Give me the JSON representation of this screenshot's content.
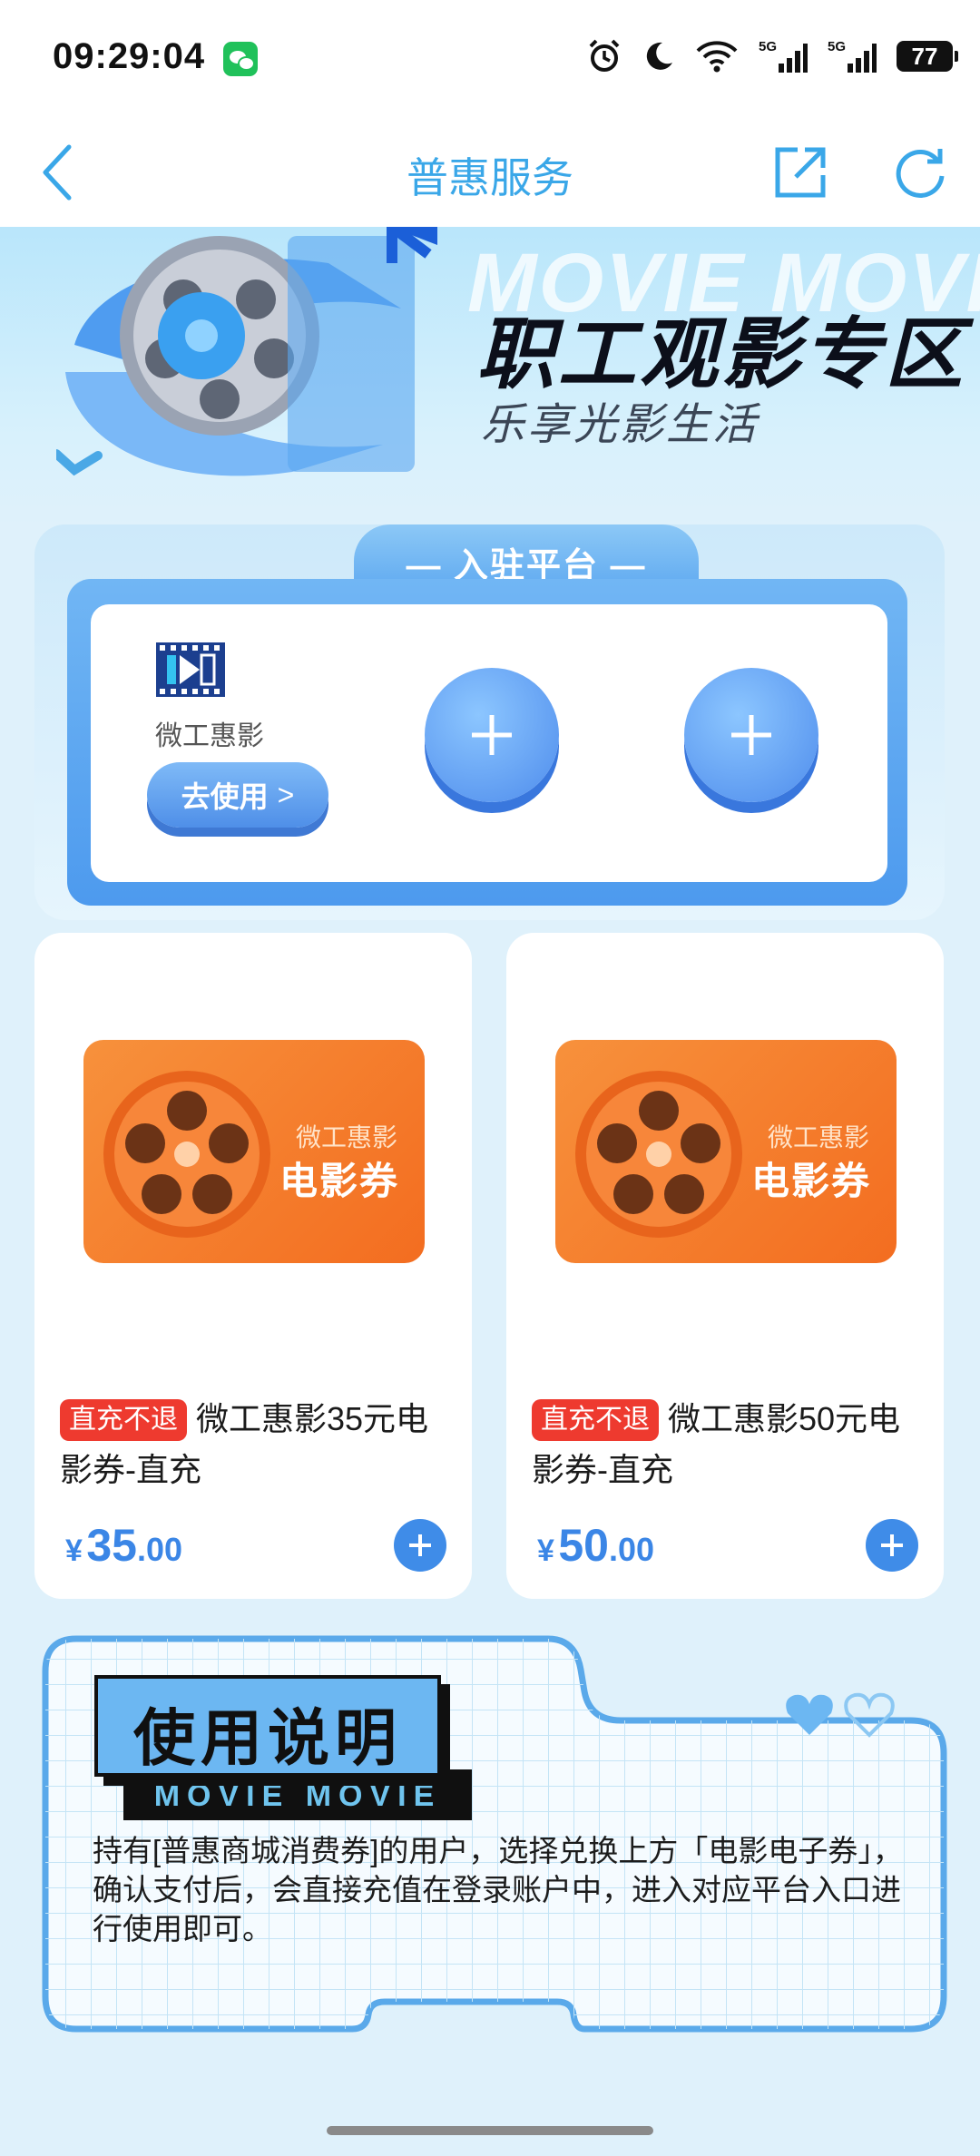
{
  "status_bar": {
    "time": "09:29:04",
    "icons": [
      "wechat-icon",
      "alarm-icon",
      "do-not-disturb-icon",
      "wifi-icon",
      "5g-signal-icon",
      "5g-signal-icon"
    ],
    "signal_labels": [
      "5G",
      "5G"
    ],
    "battery": "77"
  },
  "nav": {
    "title": "普惠服务",
    "back_icon": "chevron-left-icon",
    "share_icon": "share-external-icon",
    "refresh_icon": "refresh-icon"
  },
  "banner": {
    "watermark": "MOVIE MOVIE",
    "title": "职工观影专区",
    "subtitle": "乐享光影生活"
  },
  "platform": {
    "title": "— 入驻平台 —",
    "items": [
      {
        "name": "微工惠影",
        "button": "去使用",
        "button_arrow": ">"
      }
    ],
    "add_slots": 2
  },
  "products": [
    {
      "poster_sub": "微工惠影",
      "poster_main": "电影券",
      "tag": "直充不退",
      "title": "微工惠影35元电影券-直充",
      "currency": "¥",
      "price_int": "35",
      "price_dec": ".00"
    },
    {
      "poster_sub": "微工惠影",
      "poster_main": "电影券",
      "tag": "直充不退",
      "title": "微工惠影50元电影券-直充",
      "currency": "¥",
      "price_int": "50",
      "price_dec": ".00"
    }
  ],
  "instructions": {
    "title": "使用说明",
    "band": "MOVIE MOVIE",
    "text": "持有[普惠商城消费券]的用户，选择兑换上方「电影电子券」，确认支付后，会直接充值在登录账户中，进入对应平台入口进行使用即可。"
  },
  "colors": {
    "accent": "#3aa7e8",
    "price": "#3b86e6",
    "tag": "#ee3a2f",
    "poster": "#f36d20"
  }
}
